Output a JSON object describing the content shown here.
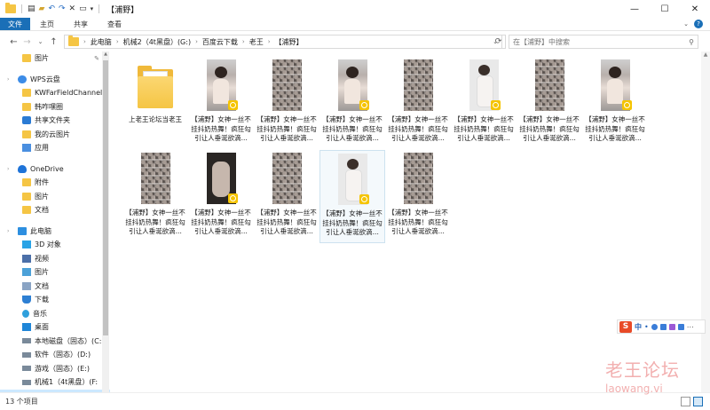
{
  "window": {
    "title": "【浦野】",
    "controls": {
      "minimize": "—",
      "maximize": "☐",
      "close": "✕"
    }
  },
  "ribbon": {
    "tabs": [
      "文件",
      "主页",
      "共享",
      "查看"
    ],
    "help": "?"
  },
  "nav": {
    "back": "←",
    "forward": "→",
    "recent": "⌄",
    "up": "↑"
  },
  "address": {
    "crumbs": [
      "此电脑",
      "机械2（4t黑盘）(G:)",
      "百度云下载",
      "老王",
      "【浦野】"
    ],
    "refresh": "⟳"
  },
  "search": {
    "placeholder": "在【浦野】中搜索"
  },
  "sidebar": {
    "items": [
      {
        "label": "图片",
        "icon": "picture-icon",
        "level": "l2",
        "pinned": true
      },
      {
        "label": "WPS云盘",
        "icon": "wps-cloud-icon",
        "level": "l1"
      },
      {
        "label": "KWFarFieldChannel",
        "icon": "folder-icon",
        "level": "l2"
      },
      {
        "label": "韩咋嘿圈",
        "icon": "folder-icon",
        "level": "l2"
      },
      {
        "label": "共享文件夹",
        "icon": "shared-folder-icon",
        "level": "l2"
      },
      {
        "label": "我的云图片",
        "icon": "folder-icon",
        "level": "l2"
      },
      {
        "label": "应用",
        "icon": "apps-icon",
        "level": "l2"
      },
      {
        "label": "OneDrive",
        "icon": "onedrive-icon",
        "level": "l1"
      },
      {
        "label": "附件",
        "icon": "folder-icon",
        "level": "l2"
      },
      {
        "label": "图片",
        "icon": "folder-icon",
        "level": "l2"
      },
      {
        "label": "文档",
        "icon": "folder-icon",
        "level": "l2"
      },
      {
        "label": "此电脑",
        "icon": "this-pc-icon",
        "level": "l1"
      },
      {
        "label": "3D 对象",
        "icon": "3d-objects-icon",
        "level": "l2"
      },
      {
        "label": "视频",
        "icon": "videos-icon",
        "level": "l2"
      },
      {
        "label": "图片",
        "icon": "pictures-icon",
        "level": "l2"
      },
      {
        "label": "文档",
        "icon": "documents-icon",
        "level": "l2"
      },
      {
        "label": "下载",
        "icon": "downloads-icon",
        "level": "l2"
      },
      {
        "label": "音乐",
        "icon": "music-icon",
        "level": "l2"
      },
      {
        "label": "桌面",
        "icon": "desktop-icon",
        "level": "l2"
      },
      {
        "label": "本地磁盘（固态）(C:",
        "icon": "drive-icon",
        "level": "l2"
      },
      {
        "label": "软件（固态）(D:)",
        "icon": "drive-icon",
        "level": "l2"
      },
      {
        "label": "游戏（固态）(E:)",
        "icon": "drive-icon",
        "level": "l2"
      },
      {
        "label": "机械1（4t黑盘）(F:",
        "icon": "drive-icon",
        "level": "l2"
      },
      {
        "label": "机械2（4t黑盘）(G:)",
        "icon": "drive-icon",
        "level": "l2",
        "selected": true
      },
      {
        "label": "机械1（4t黑盘）(F:",
        "icon": "drive-icon",
        "level": "l2"
      }
    ]
  },
  "files": [
    {
      "type": "folder",
      "name": "上老王论坛当老王"
    },
    {
      "type": "video",
      "thumb": "person",
      "badge": true,
      "name": "【浦野】女神一丝不挂抖奶热舞！疯狂勾引让人垂涎欲滴..."
    },
    {
      "type": "video",
      "thumb": "collage",
      "badge": false,
      "name": "【浦野】女神一丝不挂抖奶热舞！疯狂勾引让人垂涎欲滴..."
    },
    {
      "type": "video",
      "thumb": "person",
      "badge": true,
      "name": "【浦野】女神一丝不挂抖奶热舞！疯狂勾引让人垂涎欲滴..."
    },
    {
      "type": "video",
      "thumb": "collage",
      "badge": false,
      "name": "【浦野】女神一丝不挂抖奶热舞！疯狂勾引让人垂涎欲滴..."
    },
    {
      "type": "video",
      "thumb": "light",
      "badge": true,
      "name": "【浦野】女神一丝不挂抖奶热舞！疯狂勾引让人垂涎欲滴..."
    },
    {
      "type": "video",
      "thumb": "collage",
      "badge": false,
      "name": "【浦野】女神一丝不挂抖奶热舞！疯狂勾引让人垂涎欲滴..."
    },
    {
      "type": "video",
      "thumb": "person",
      "badge": true,
      "name": "【浦野】女神一丝不挂抖奶热舞！疯狂勾引让人垂涎欲滴..."
    },
    {
      "type": "video",
      "thumb": "collage",
      "badge": false,
      "name": "【浦野】女神一丝不挂抖奶热舞！疯狂勾引让人垂涎欲滴..."
    },
    {
      "type": "video",
      "thumb": "dark",
      "badge": true,
      "name": "【浦野】女神一丝不挂抖奶热舞！疯狂勾引让人垂涎欲滴..."
    },
    {
      "type": "video",
      "thumb": "collage",
      "badge": false,
      "name": "【浦野】女神一丝不挂抖奶热舞！疯狂勾引让人垂涎欲滴..."
    },
    {
      "type": "video",
      "thumb": "light",
      "badge": true,
      "selected": true,
      "name": "【浦野】女神一丝不挂抖奶热舞！疯狂勾引让人垂涎欲滴..."
    },
    {
      "type": "video",
      "thumb": "collage",
      "badge": false,
      "name": "【浦野】女神一丝不挂抖奶热舞！疯狂勾引让人垂涎欲滴..."
    }
  ],
  "status": {
    "count": "13 个项目"
  },
  "ime": {
    "logo": "S",
    "mode": "中",
    "punct": "•",
    "extra": "⋯"
  },
  "watermark": {
    "cn": "老王论坛",
    "en": "laowang.vi"
  }
}
